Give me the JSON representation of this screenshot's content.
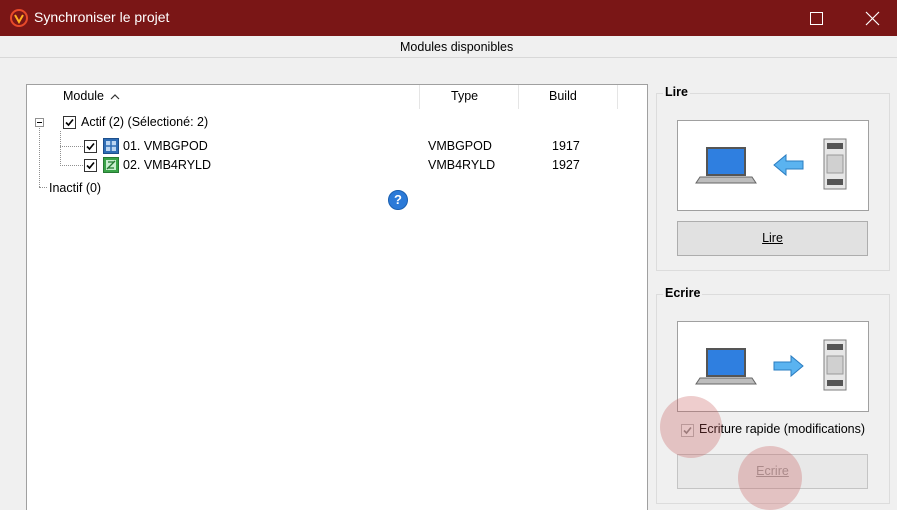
{
  "window": {
    "title": "Synchroniser le projet",
    "icon": "app-logo-icon",
    "accent_color": "#7a1616"
  },
  "modules": {
    "title": "Modules disponibles",
    "columns": {
      "module": "Module",
      "type": "Type",
      "build": "Build"
    },
    "active_group": "Actif (2) (Sélectioné: 2)",
    "inactive_group": "Inactif (0)",
    "rows": [
      {
        "name": "01. VMBGPOD",
        "type": "VMBGPOD",
        "build": "1917",
        "checked": true,
        "icon": "glass-panel-icon"
      },
      {
        "name": "02. VMB4RYLD",
        "type": "VMB4RYLD",
        "build": "1927",
        "checked": true,
        "icon": "relay-module-icon"
      }
    ]
  },
  "read": {
    "title": "Lire",
    "button_label": "Lire"
  },
  "write": {
    "title": "Ecrire",
    "fast_write_label": "Ecriture rapide (modifications)",
    "fast_write_checked": true,
    "button_label": "Ecrire"
  }
}
